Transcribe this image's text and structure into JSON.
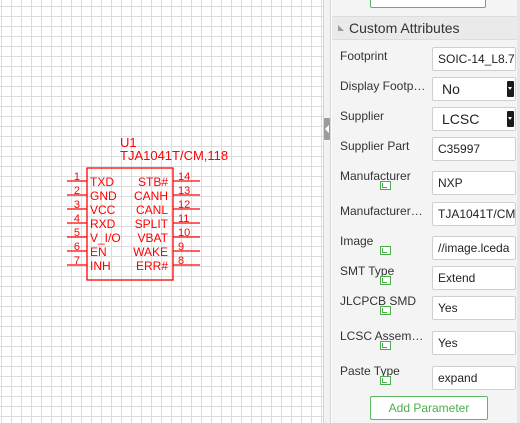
{
  "schematic": {
    "designator": "U1",
    "part_name": "TJA1041T/CM,118",
    "color": "#ff0000",
    "left_pins": [
      {
        "num": "1",
        "name": "TXD"
      },
      {
        "num": "2",
        "name": "GND"
      },
      {
        "num": "3",
        "name": "VCC"
      },
      {
        "num": "4",
        "name": "RXD"
      },
      {
        "num": "5",
        "name": "V_I/O"
      },
      {
        "num": "6",
        "name": "EN"
      },
      {
        "num": "7",
        "name": "INH"
      }
    ],
    "right_pins": [
      {
        "num": "14",
        "name": "STB#"
      },
      {
        "num": "13",
        "name": "CANH"
      },
      {
        "num": "12",
        "name": "CANL"
      },
      {
        "num": "11",
        "name": "SPLIT"
      },
      {
        "num": "10",
        "name": "VBAT"
      },
      {
        "num": "9",
        "name": "WAKE"
      },
      {
        "num": "8",
        "name": "ERR#"
      }
    ]
  },
  "panel": {
    "section_title": "Custom Attributes",
    "rows": [
      {
        "label": "Footprint",
        "value": "SOIC-14_L8.7",
        "type": "input",
        "icon": false
      },
      {
        "label": "Display Footprint",
        "value": "No",
        "type": "select",
        "icon": false
      },
      {
        "label": "Supplier",
        "value": "LCSC",
        "type": "select",
        "icon": false
      },
      {
        "label": "Supplier Part",
        "value": "C35997",
        "type": "input",
        "icon": false
      },
      {
        "label": "Manufacturer",
        "value": "NXP",
        "type": "input",
        "icon": true
      },
      {
        "label": "Manufacturer Part",
        "value": "TJA1041T/CM",
        "type": "input",
        "icon": false
      },
      {
        "label": "Image",
        "value": "//image.lceda",
        "type": "input",
        "icon": true
      },
      {
        "label": "SMT Type",
        "value": "Extend",
        "type": "input",
        "icon": true
      },
      {
        "label": "JLCPCB SMD",
        "value": "Yes",
        "type": "input",
        "icon": true
      },
      {
        "label": "LCSC Assembly",
        "value": "Yes",
        "type": "input",
        "icon": true
      },
      {
        "label": "Paste Type",
        "value": "expand",
        "type": "input",
        "icon": true
      }
    ],
    "add_parameter_label": "Add Parameter",
    "icons": {
      "section": "collapse-arrow-icon",
      "row": "edit-link-icon",
      "select": "dropdown-arrow-icon"
    }
  }
}
